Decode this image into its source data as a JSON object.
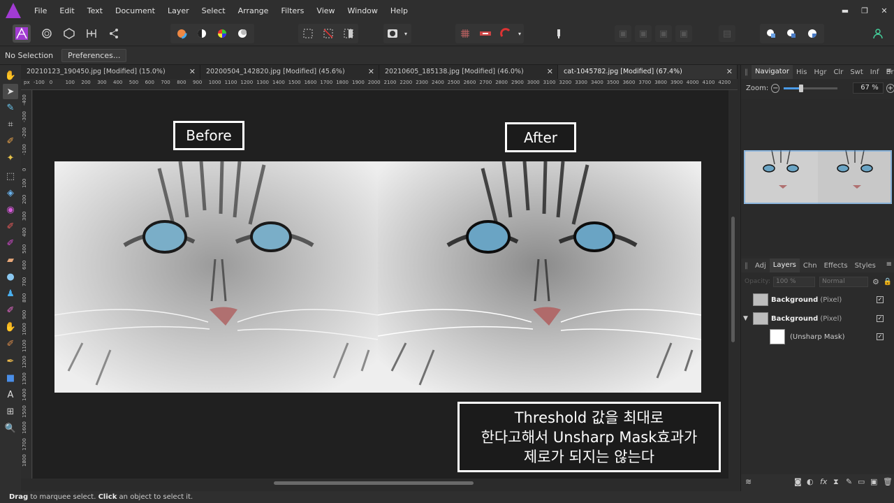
{
  "menu": [
    "File",
    "Edit",
    "Text",
    "Document",
    "Layer",
    "Select",
    "Arrange",
    "Filters",
    "View",
    "Window",
    "Help"
  ],
  "window_controls": {
    "minimize": "▬",
    "restore": "❐",
    "close": "✕"
  },
  "context": {
    "selection": "No Selection",
    "preferences": "Preferences..."
  },
  "tabs": [
    {
      "label": "20210123_190450.jpg [Modified] (15.0%)",
      "close": "✕"
    },
    {
      "label": "20200504_142820.jpg [Modified] (45.6%)",
      "close": "✕"
    },
    {
      "label": "20210605_185138.jpg [Modified] (46.0%)",
      "close": "✕"
    },
    {
      "label": "cat-1045782.jpg [Modified] (67.4%)",
      "close": "✕"
    }
  ],
  "ruler": {
    "unit": "px",
    "h_ticks": [
      "-100",
      "0",
      "100",
      "200",
      "300",
      "400",
      "500",
      "600",
      "700",
      "800",
      "900",
      "1000",
      "1100",
      "1200",
      "1300",
      "1400",
      "1500",
      "1600",
      "1700",
      "1800",
      "1900",
      "2000",
      "2100",
      "2200",
      "2300",
      "2400",
      "2500",
      "2600",
      "2700",
      "2800",
      "2900",
      "3000",
      "3100",
      "3200",
      "3300",
      "3400",
      "3500",
      "3600",
      "3700",
      "3800",
      "3900",
      "4000",
      "4100",
      "4200"
    ],
    "v_ticks": [
      "-400",
      "-300",
      "-200",
      "-100",
      "0",
      "100",
      "200",
      "300",
      "400",
      "500",
      "600",
      "700",
      "800",
      "900",
      "1000",
      "1100",
      "1200",
      "1300",
      "1400",
      "1500",
      "1600",
      "1700",
      "1800"
    ]
  },
  "canvas": {
    "before_label": "Before",
    "after_label": "After",
    "note_lines": [
      "Threshold 값을 최대로",
      "한다고해서 Unsharp Mask효과가",
      "제로가 되지는 않는다"
    ]
  },
  "navigator": {
    "tabs": [
      "Navigator",
      "His",
      "Hgr",
      "Clr",
      "Swt",
      "Inf",
      "Brs"
    ],
    "menu": "≡",
    "zoom_label": "Zoom:",
    "zoom_value": "67 %",
    "zoom_fraction": 0.67
  },
  "layers_panel": {
    "tabs": [
      "Adj",
      "Layers",
      "Chn",
      "Effects",
      "Styles"
    ],
    "menu": "≡",
    "opacity_label": "Opacity:",
    "opacity_value": "100 %",
    "blend_mode": "Normal",
    "rows": [
      {
        "name": "Background",
        "type": "(Pixel)",
        "checked": "✓"
      },
      {
        "name": "Background",
        "type": "(Pixel)",
        "checked": "✓"
      },
      {
        "name": "",
        "type": "(Unsharp Mask)",
        "checked": "✓"
      }
    ]
  },
  "status": {
    "drag": "Drag",
    "drag_text": " to marquee select. ",
    "click": "Click",
    "click_text": " an object to select it."
  },
  "colors": {
    "accent": "#4a9be8",
    "app_logo": "#a23bd3",
    "panel_bg": "#2b2b2b",
    "canvas_bg": "#202020"
  }
}
